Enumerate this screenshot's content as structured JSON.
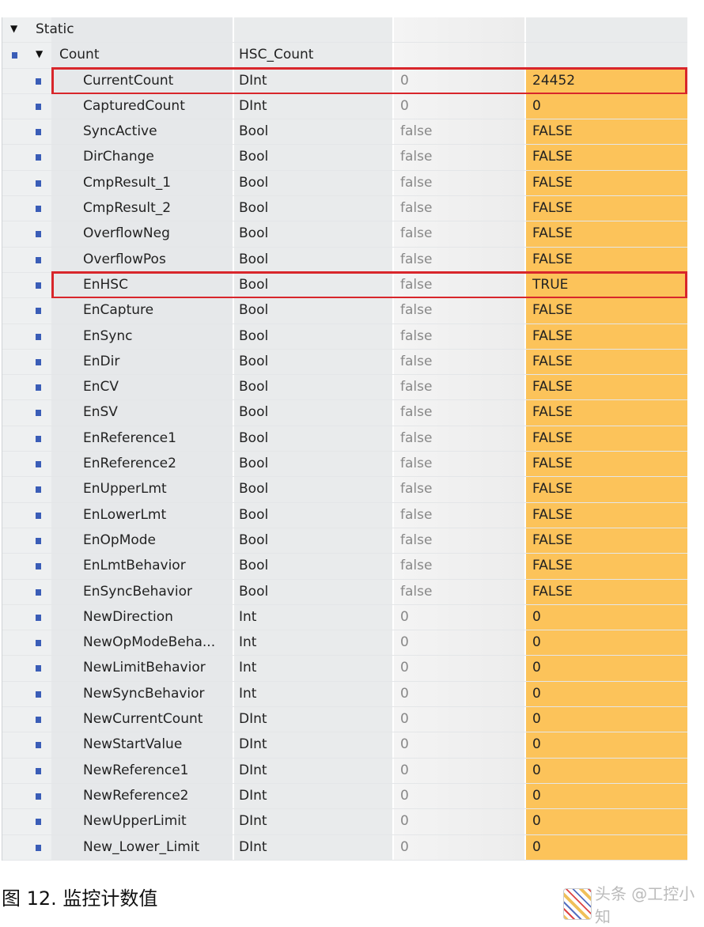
{
  "header_rows": [
    {
      "name": "Static",
      "type": ""
    },
    {
      "name": "Count",
      "type": "HSC_Count"
    }
  ],
  "rows": [
    {
      "name": "CurrentCount",
      "type": "DInt",
      "start": "0",
      "monitor": "24452",
      "highlight": true
    },
    {
      "name": "CapturedCount",
      "type": "DInt",
      "start": "0",
      "monitor": "0"
    },
    {
      "name": "SyncActive",
      "type": "Bool",
      "start": "false",
      "monitor": "FALSE"
    },
    {
      "name": "DirChange",
      "type": "Bool",
      "start": "false",
      "monitor": "FALSE"
    },
    {
      "name": "CmpResult_1",
      "type": "Bool",
      "start": "false",
      "monitor": "FALSE"
    },
    {
      "name": "CmpResult_2",
      "type": "Bool",
      "start": "false",
      "monitor": "FALSE"
    },
    {
      "name": "OverflowNeg",
      "type": "Bool",
      "start": "false",
      "monitor": "FALSE"
    },
    {
      "name": "OverflowPos",
      "type": "Bool",
      "start": "false",
      "monitor": "FALSE"
    },
    {
      "name": "EnHSC",
      "type": "Bool",
      "start": "false",
      "monitor": "TRUE",
      "highlight": true
    },
    {
      "name": "EnCapture",
      "type": "Bool",
      "start": "false",
      "monitor": "FALSE"
    },
    {
      "name": "EnSync",
      "type": "Bool",
      "start": "false",
      "monitor": "FALSE"
    },
    {
      "name": "EnDir",
      "type": "Bool",
      "start": "false",
      "monitor": "FALSE"
    },
    {
      "name": "EnCV",
      "type": "Bool",
      "start": "false",
      "monitor": "FALSE"
    },
    {
      "name": "EnSV",
      "type": "Bool",
      "start": "false",
      "monitor": "FALSE"
    },
    {
      "name": "EnReference1",
      "type": "Bool",
      "start": "false",
      "monitor": "FALSE"
    },
    {
      "name": "EnReference2",
      "type": "Bool",
      "start": "false",
      "monitor": "FALSE"
    },
    {
      "name": "EnUpperLmt",
      "type": "Bool",
      "start": "false",
      "monitor": "FALSE"
    },
    {
      "name": "EnLowerLmt",
      "type": "Bool",
      "start": "false",
      "monitor": "FALSE"
    },
    {
      "name": "EnOpMode",
      "type": "Bool",
      "start": "false",
      "monitor": "FALSE"
    },
    {
      "name": "EnLmtBehavior",
      "type": "Bool",
      "start": "false",
      "monitor": "FALSE"
    },
    {
      "name": "EnSyncBehavior",
      "type": "Bool",
      "start": "false",
      "monitor": "FALSE"
    },
    {
      "name": "NewDirection",
      "type": "Int",
      "start": "0",
      "monitor": "0"
    },
    {
      "name": "NewOpModeBeha...",
      "type": "Int",
      "start": "0",
      "monitor": "0"
    },
    {
      "name": "NewLimitBehavior",
      "type": "Int",
      "start": "0",
      "monitor": "0"
    },
    {
      "name": "NewSyncBehavior",
      "type": "Int",
      "start": "0",
      "monitor": "0"
    },
    {
      "name": "NewCurrentCount",
      "type": "DInt",
      "start": "0",
      "monitor": "0"
    },
    {
      "name": "NewStartValue",
      "type": "DInt",
      "start": "0",
      "monitor": "0"
    },
    {
      "name": "NewReference1",
      "type": "DInt",
      "start": "0",
      "monitor": "0"
    },
    {
      "name": "NewReference2",
      "type": "DInt",
      "start": "0",
      "monitor": "0"
    },
    {
      "name": "NewUpperLimit",
      "type": "DInt",
      "start": "0",
      "monitor": "0"
    },
    {
      "name": "New_Lower_Limit",
      "type": "DInt",
      "start": "0",
      "monitor": "0"
    }
  ],
  "colors": {
    "monitor_bg": "#fcc35a",
    "highlight_border": "#d8262b",
    "member_icon": "#3a5db7"
  },
  "caption": "图 12. 监控计数值",
  "watermark": "头条 @工控小知"
}
